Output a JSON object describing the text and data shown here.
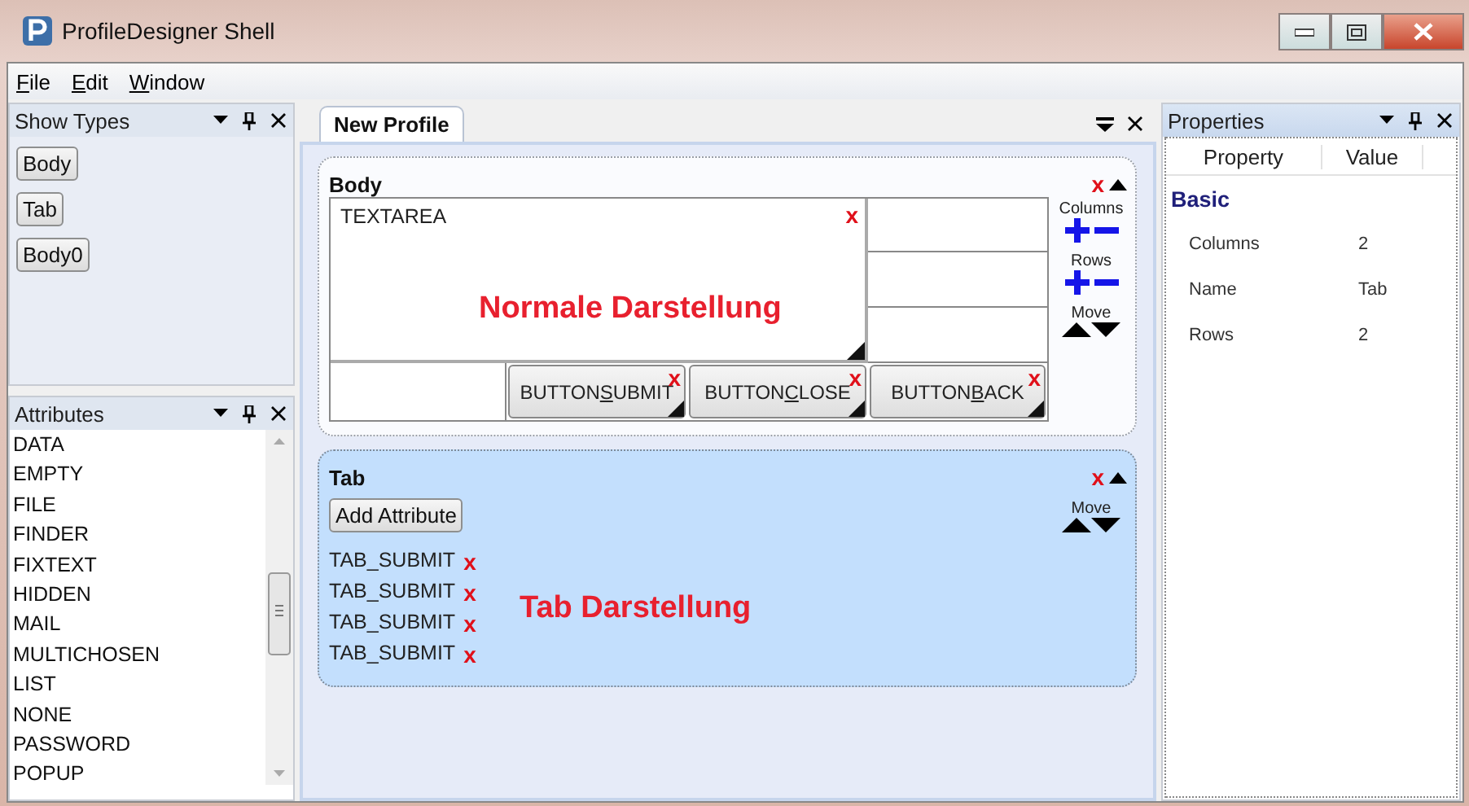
{
  "window": {
    "title": "ProfileDesigner Shell"
  },
  "menu": [
    {
      "key": "F",
      "rest": "ile"
    },
    {
      "key": "E",
      "rest": "dit"
    },
    {
      "key": "W",
      "rest": "indow"
    }
  ],
  "show_types": {
    "title": "Show Types",
    "items": [
      "Body",
      "Tab",
      "Body0"
    ]
  },
  "attributes": {
    "title": "Attributes",
    "items": [
      "DATA",
      "EMPTY",
      "FILE",
      "FINDER",
      "FIXTEXT",
      "HIDDEN",
      "MAIL",
      "MULTICHOSEN",
      "LIST",
      "NONE",
      "PASSWORD",
      "POPUP"
    ]
  },
  "document": {
    "tabs": [
      {
        "label": "New Profile",
        "selected": true
      }
    ],
    "body": {
      "title": "Body",
      "delete": "x",
      "textarea": {
        "label": "TEXTAREA",
        "delete": "x"
      },
      "buttons": [
        {
          "before": "BUTTON",
          "key": "S",
          "after": "UBMIT",
          "delete": "x"
        },
        {
          "before": "BUTTON",
          "key": "C",
          "after": "LOSE",
          "delete": "x"
        },
        {
          "before": "BUTTON",
          "key": "B",
          "after": "ACK",
          "delete": "x"
        }
      ],
      "columns_label": "Columns",
      "rows_label": "Rows",
      "move_label": "Move",
      "annotation": "Normale Darstellung"
    },
    "tab": {
      "title": "Tab",
      "delete": "x",
      "add_button": "Add Attribute",
      "items": [
        {
          "label": "TAB_SUBMIT",
          "delete": "x"
        },
        {
          "label": "TAB_SUBMIT",
          "delete": "x"
        },
        {
          "label": "TAB_SUBMIT",
          "delete": "x"
        },
        {
          "label": "TAB_SUBMIT",
          "delete": "x"
        }
      ],
      "move_label": "Move",
      "annotation": "Tab Darstellung"
    }
  },
  "properties": {
    "title": "Properties",
    "columns": [
      "Property",
      "Value"
    ],
    "category": "Basic",
    "rows": [
      {
        "name": "Columns",
        "value": "2"
      },
      {
        "name": "Name",
        "value": "Tab"
      },
      {
        "name": "Rows",
        "value": "2"
      }
    ]
  }
}
